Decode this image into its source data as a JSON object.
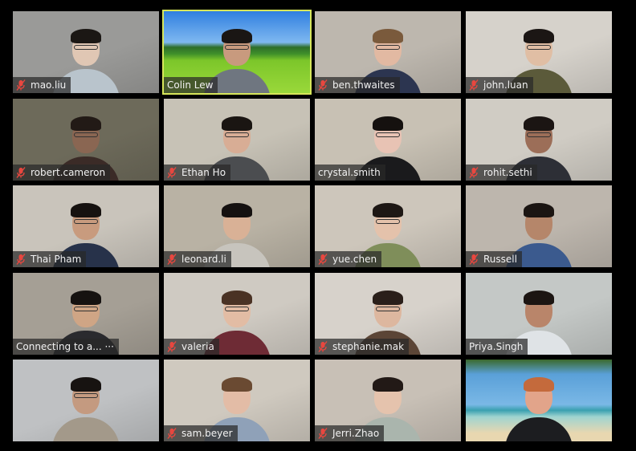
{
  "app": "Zoom Gallery View",
  "participants": [
    {
      "name": "mao.liu",
      "muted": true,
      "active": false,
      "bg": "#9a9a98",
      "skin": "#e0c7b4",
      "hair": "#1b1714",
      "shirt": "#b9c4cc",
      "glasses": true
    },
    {
      "name": "Colin Lew",
      "muted": false,
      "active": true,
      "bg": "virtual-meadow",
      "skin": "#c89a7e",
      "hair": "#1a1614",
      "shirt": "#6f7680",
      "glasses": true
    },
    {
      "name": "ben.thwaites",
      "muted": true,
      "active": false,
      "bg": "#bdb7ae",
      "skin": "#e2b9a2",
      "hair": "#7a5a3c",
      "shirt": "#2c3550",
      "glasses": true
    },
    {
      "name": "john.luan",
      "muted": true,
      "active": false,
      "bg": "#d6d2cb",
      "skin": "#e0bea4",
      "hair": "#1b1614",
      "shirt": "#5b5a3a",
      "glasses": true
    },
    {
      "name": "robert.cameron",
      "muted": true,
      "active": false,
      "bg": "#6d6a5a",
      "skin": "#8a6652",
      "hair": "#221a16",
      "shirt": "#3b2b27",
      "glasses": true
    },
    {
      "name": "Ethan Ho",
      "muted": true,
      "active": false,
      "bg": "#c7c2b6",
      "skin": "#d8ad95",
      "hair": "#1a1512",
      "shirt": "#4b4d50",
      "glasses": true
    },
    {
      "name": "crystal.smith",
      "muted": false,
      "active": false,
      "bg": "#c8c1b4",
      "skin": "#e8c3b4",
      "hair": "#15110f",
      "shirt": "#1a1a1c",
      "glasses": true
    },
    {
      "name": "rohit.sethi",
      "muted": true,
      "active": false,
      "bg": "#d0ccc4",
      "skin": "#9c6e58",
      "hair": "#1b1513",
      "shirt": "#2d2f36",
      "glasses": true
    },
    {
      "name": "Thai Pham",
      "muted": true,
      "active": false,
      "bg": "#c9c4bb",
      "skin": "#c89b7e",
      "hair": "#161210",
      "shirt": "#27324a",
      "glasses": true
    },
    {
      "name": "leonard.li",
      "muted": true,
      "active": false,
      "bg": "#b9b2a4",
      "skin": "#d9b196",
      "hair": "#151110",
      "shirt": "#c7c4bd",
      "glasses": false
    },
    {
      "name": "yue.chen",
      "muted": true,
      "active": false,
      "bg": "#cdc6bb",
      "skin": "#e4c2ab",
      "hair": "#1d1714",
      "shirt": "#7f8e5a",
      "glasses": true
    },
    {
      "name": "Russell",
      "muted": true,
      "active": false,
      "bg": "#bdb6ad",
      "skin": "#b5866a",
      "hair": "#1b1512",
      "shirt": "#3b5a8e",
      "glasses": false
    },
    {
      "name": "Connecting to a... ···",
      "muted": false,
      "active": false,
      "bg": "#a59f95",
      "skin": "#cfa585",
      "hair": "#161210",
      "shirt": "#2a2a2e",
      "glasses": true
    },
    {
      "name": "valeria",
      "muted": true,
      "active": false,
      "bg": "#cfcac2",
      "skin": "#e2bca4",
      "hair": "#4a3224",
      "shirt": "#6e2b35",
      "glasses": true
    },
    {
      "name": "stephanie.mak",
      "muted": true,
      "active": false,
      "bg": "#d7d2cb",
      "skin": "#ddb79f",
      "hair": "#2a1f1a",
      "shirt": "#5b4536",
      "glasses": true
    },
    {
      "name": "Priya.Singh",
      "muted": false,
      "active": false,
      "bg": "#c4c8c6",
      "skin": "#b9856a",
      "hair": "#1c1512",
      "shirt": "#dfe3e6",
      "glasses": false
    },
    {
      "name": "",
      "muted": false,
      "active": false,
      "bg": "#bfc1c3",
      "skin": "#c49a80",
      "hair": "#171311",
      "shirt": "#a3998a",
      "glasses": true
    },
    {
      "name": "sam.beyer",
      "muted": true,
      "active": false,
      "bg": "#cfc9bf",
      "skin": "#e3bca6",
      "hair": "#6a4a32",
      "shirt": "#8fa1b8",
      "glasses": false
    },
    {
      "name": "Jerri.Zhao",
      "muted": true,
      "active": false,
      "bg": "#c8c0b6",
      "skin": "#e5c3ad",
      "hair": "#221916",
      "shirt": "#aab5ad",
      "glasses": false
    },
    {
      "name": "",
      "muted": false,
      "active": false,
      "bg": "virtual-beach",
      "skin": "#e2a48a",
      "hair": "#c46a3c",
      "shirt": "#1c1d20",
      "glasses": false
    }
  ],
  "colors": {
    "active_speaker_border": "#d7e65a",
    "muted_icon": "#e8473f",
    "nameplate_text": "#f2f2f2"
  }
}
